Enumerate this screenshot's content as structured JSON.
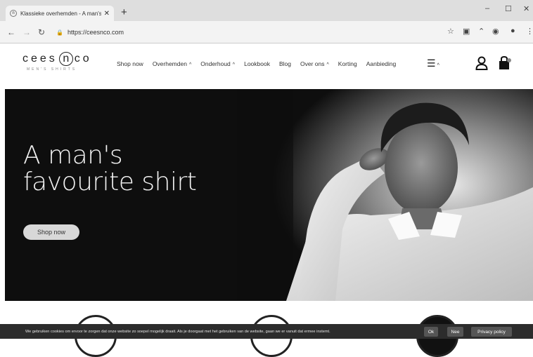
{
  "browser": {
    "tab_title": "Klassieke overhemden - A man's",
    "tab_favicon": "cees-n-co-favicon",
    "new_tab": "+",
    "win_min": "–",
    "win_max": "☐",
    "win_close": "✕",
    "url": "https://ceesnco.com"
  },
  "site": {
    "logo_left": "cees",
    "logo_n": "n",
    "logo_right": "co",
    "logo_sub": "MEN'S SHIRTS",
    "menu": [
      {
        "label": "Shop now",
        "dropdown": false
      },
      {
        "label": "Overhemden",
        "dropdown": true
      },
      {
        "label": "Onderhoud",
        "dropdown": true
      },
      {
        "label": "Lookbook",
        "dropdown": false
      },
      {
        "label": "Blog",
        "dropdown": false
      },
      {
        "label": "Over ons",
        "dropdown": true
      },
      {
        "label": "Korting",
        "dropdown": false
      },
      {
        "label": "Aanbieding",
        "dropdown": false
      }
    ],
    "caret": "^"
  },
  "hero": {
    "headline_line1": "A man's",
    "headline_line2": "favourite shirt",
    "cta": "Shop now"
  },
  "cookie": {
    "text": "We gebruiken cookies om ervoor te zorgen dat onze website zo soepel mogelijk draait. Als je doorgaat met het gebruiken van de website, gaan we er vanuit dat ermee instemt.",
    "ok": "Ok",
    "nee": "Nee",
    "privacy": "Privacy policy"
  }
}
